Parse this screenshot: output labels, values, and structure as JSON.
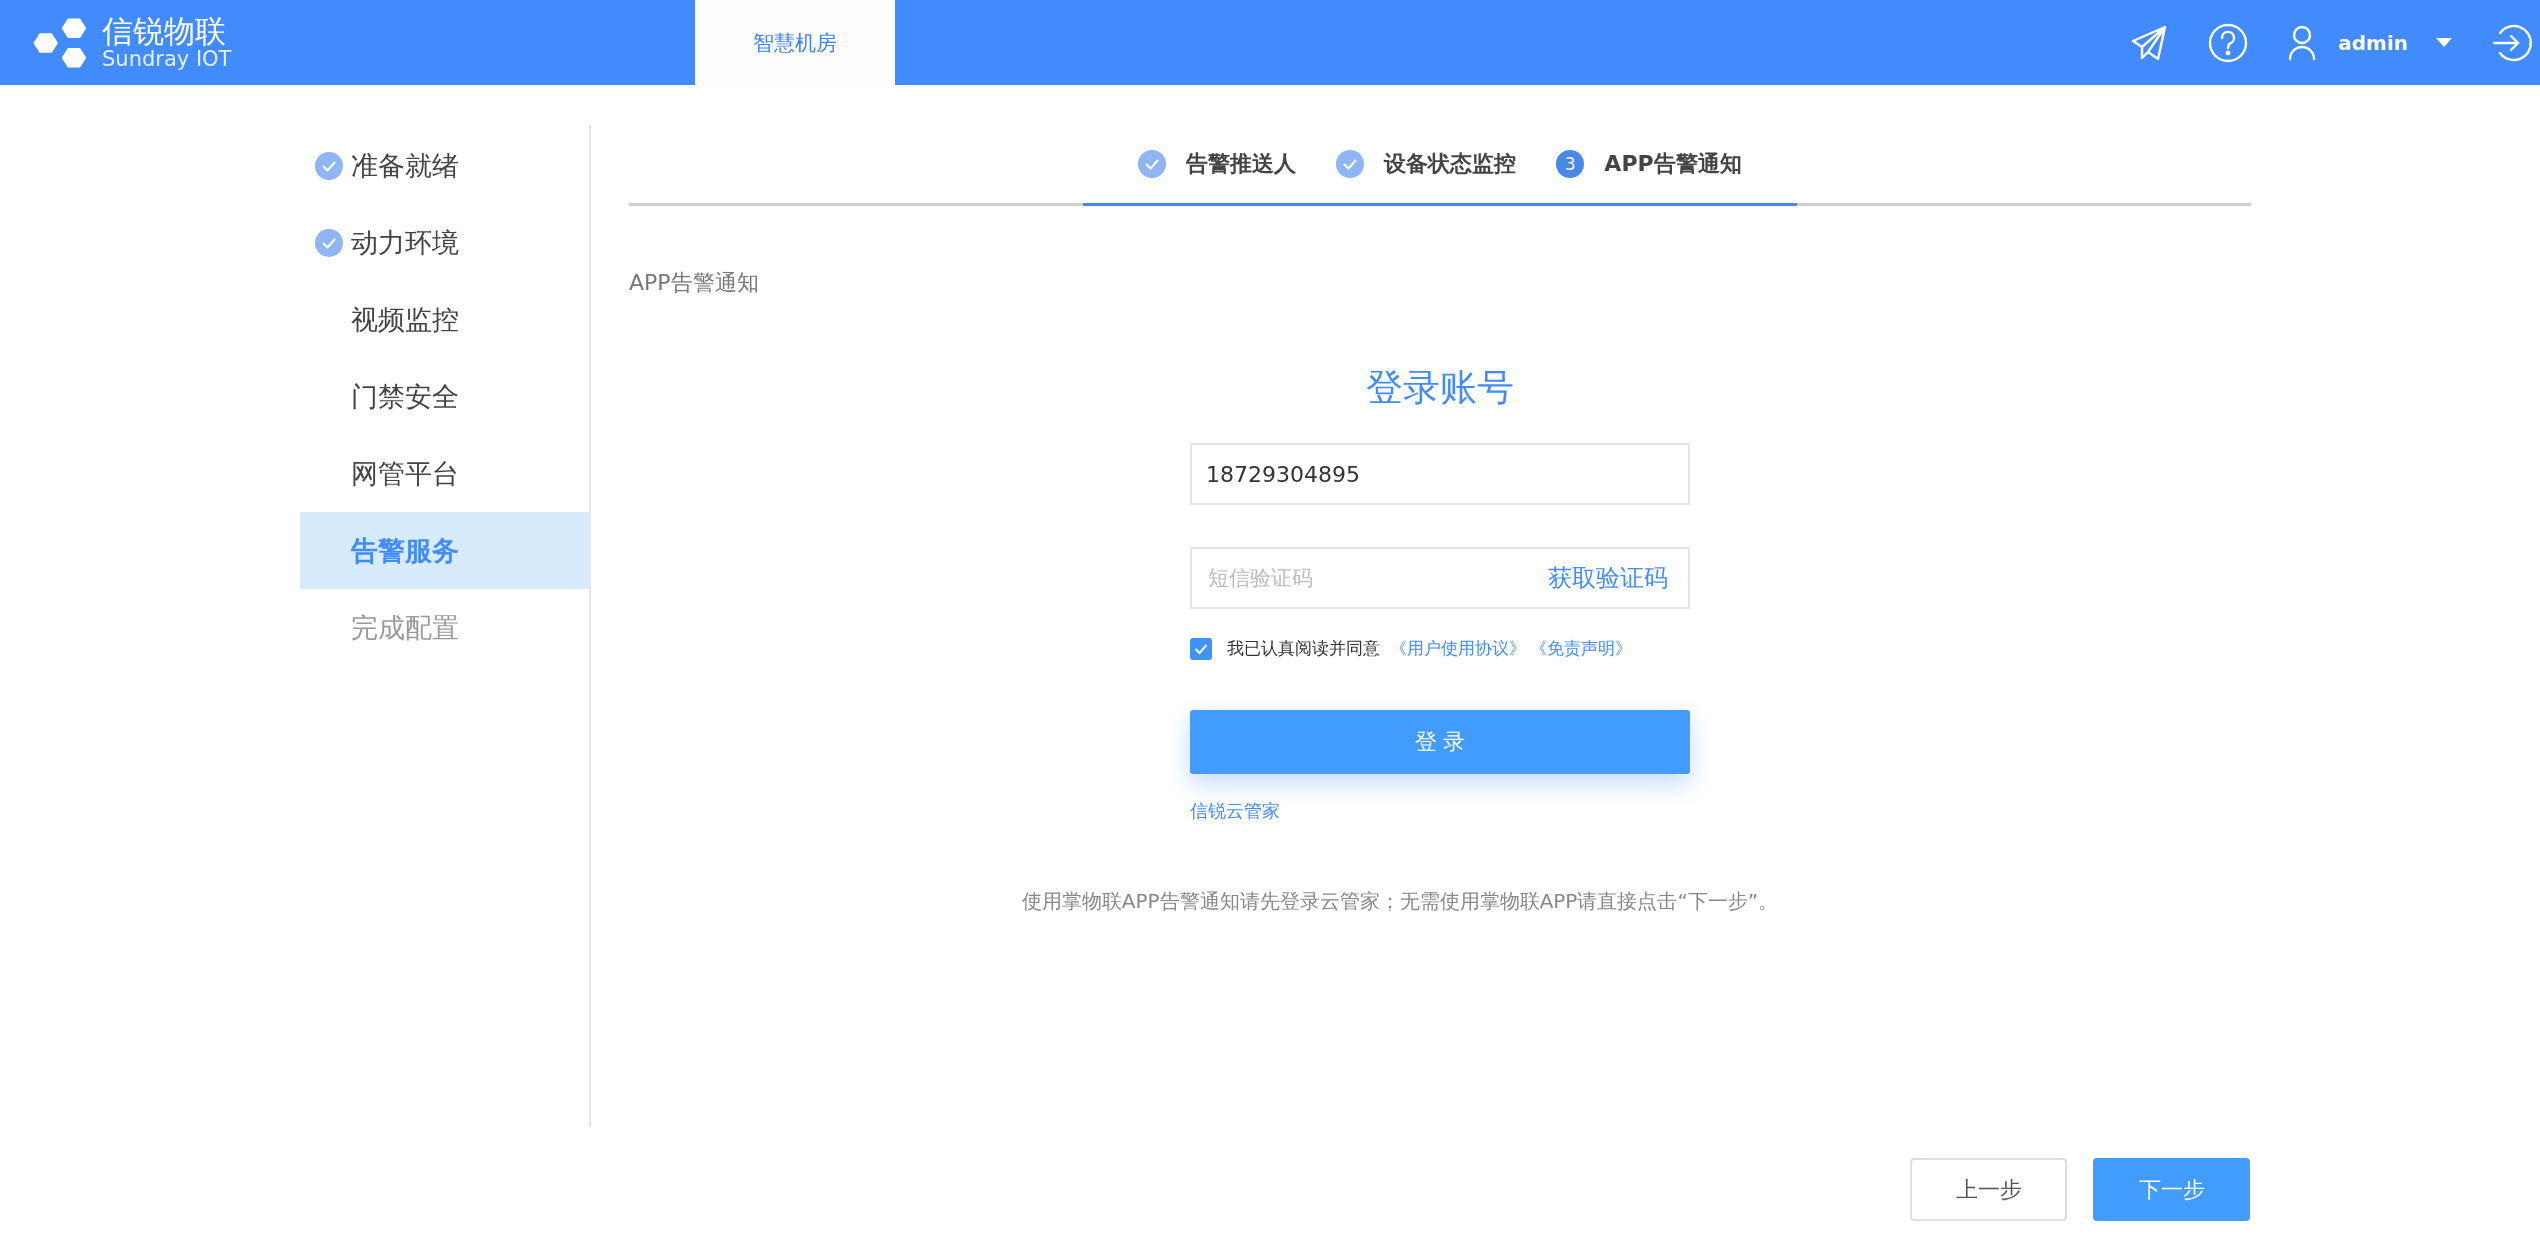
{
  "header": {
    "brand": "信锐物联",
    "brand_sub": "Sundray IOT",
    "tabs": [
      {
        "label": "智慧机房",
        "selected": true
      }
    ],
    "user": "admin"
  },
  "sidebar": {
    "items": [
      {
        "label": "准备就绪",
        "done": true,
        "selected": false,
        "disabled": false
      },
      {
        "label": "动力环境",
        "done": true,
        "selected": false,
        "disabled": false
      },
      {
        "label": "视频监控",
        "done": false,
        "selected": false,
        "disabled": false
      },
      {
        "label": "门禁安全",
        "done": false,
        "selected": false,
        "disabled": false
      },
      {
        "label": "网管平台",
        "done": false,
        "selected": false,
        "disabled": false
      },
      {
        "label": "告警服务",
        "done": false,
        "selected": true,
        "disabled": false
      },
      {
        "label": "完成配置",
        "done": false,
        "selected": false,
        "disabled": true
      }
    ]
  },
  "steps": [
    {
      "label": "告警推送人",
      "done": true
    },
    {
      "label": "设备状态监控",
      "done": true
    },
    {
      "label": "APP告警通知",
      "done": false,
      "number": "3"
    }
  ],
  "section_title": "APP告警通知",
  "login": {
    "title": "登录账号",
    "phone": "18729304895",
    "code_placeholder": "短信验证码",
    "get_code": "获取验证码",
    "agree_checked": true,
    "agree_text": "我已认真阅读并同意",
    "agreement_links": [
      "《用户使用协议》",
      "《免责声明》"
    ],
    "login_button": "登 录",
    "cloud_link": "信锐云管家"
  },
  "note": "使用掌物联APP告警通知请先登录云管家；无需使用掌物联APP请直接点击“下一步”。",
  "footer_buttons": [
    {
      "label": "上一步",
      "kind": "secondary"
    },
    {
      "label": "下一步",
      "kind": "primary"
    }
  ]
}
